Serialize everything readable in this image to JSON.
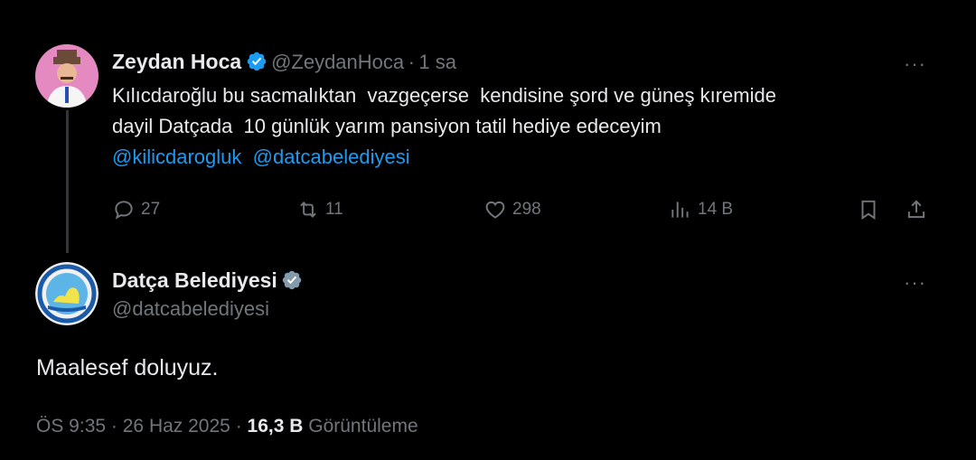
{
  "tweet": {
    "author_name": "Zeydan Hoca",
    "author_handle": "@ZeydanHoca",
    "separator": "·",
    "time_ago": "1 sa",
    "more": "···",
    "text_line1": "Kılıcdaroğlu bu sacmalıktan  vazgeçerse  kendisine şord ve güneş kıremide",
    "text_line2": "dayil Datçada  10 günlük yarım pansiyon tatil hediye edeceyim",
    "mention1": "@kilicdarogluk",
    "mention2": "@datcabelediyesi",
    "actions": {
      "replies": "27",
      "retweets": "11",
      "likes": "298",
      "views": "14 B"
    },
    "icons": [
      "reply-icon",
      "retweet-icon",
      "like-icon",
      "views-icon",
      "bookmark-icon",
      "share-icon"
    ]
  },
  "reply": {
    "author_name": "Datça Belediyesi",
    "author_handle": "@datcabelediyesi",
    "more": "···",
    "text": "Maalesef doluyuz.",
    "time": "ÖS 9:35",
    "separator1": "·",
    "date": "26 Haz 2025",
    "separator2": "·",
    "views_count": "16,3 B",
    "views_label": "Görüntüleme"
  },
  "colors": {
    "background": "#000000",
    "text": "#e7e9ea",
    "muted": "#71767b",
    "link": "#1d9bf0",
    "verified_blue": "#1d9bf0",
    "verified_gray": "#829aab"
  }
}
